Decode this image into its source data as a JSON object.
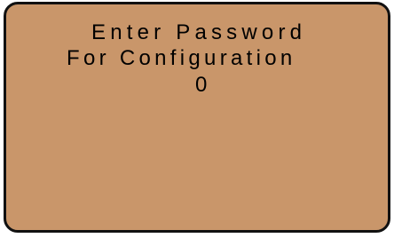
{
  "screen": {
    "background": "#c9966a",
    "border_color": "#111111",
    "text_color": "#000000",
    "lines": [
      "Enter Password",
      "For Configuration",
      "0"
    ]
  }
}
